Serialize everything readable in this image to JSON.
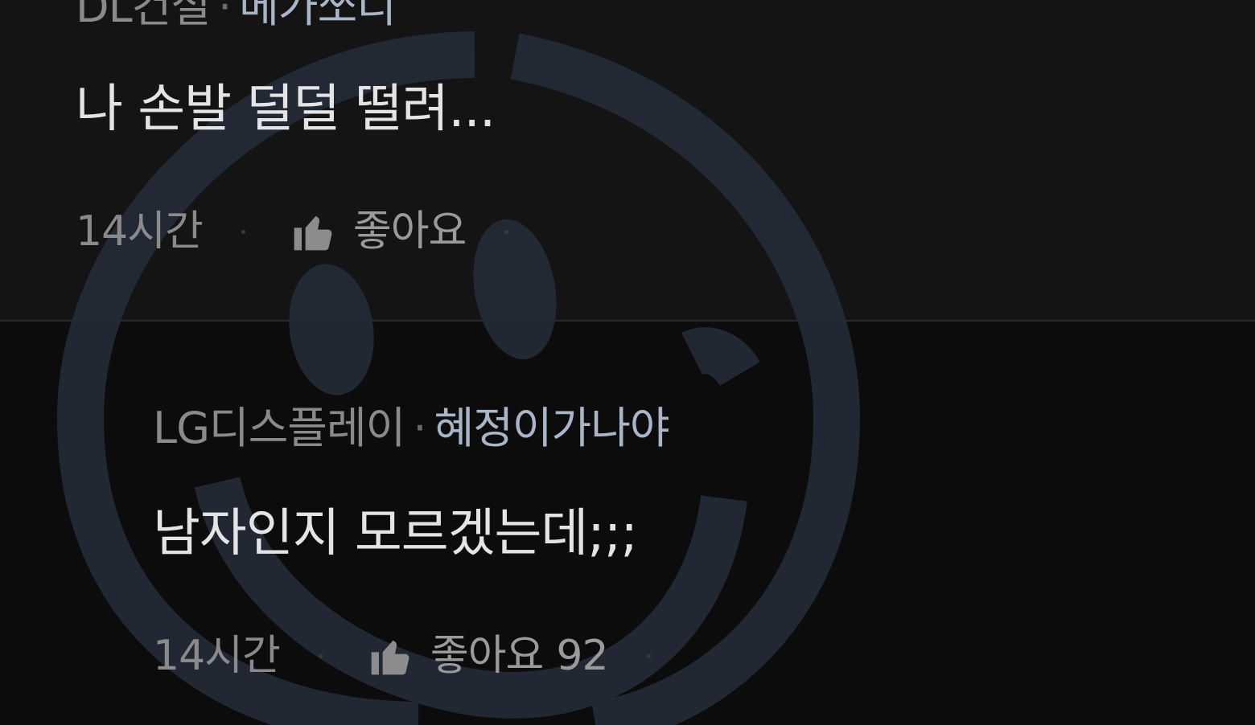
{
  "comments": [
    {
      "company": "DL건설",
      "separator": "·",
      "nickname": "메가쏘디",
      "text": "나 손발 덜덜 떨려...",
      "time": "14시간",
      "like_label": "좋아요",
      "like_count": ""
    },
    {
      "company": "LG디스플레이",
      "separator": "·",
      "nickname": "혜정이가나야",
      "text": "남자인지 모르겠는데;;;",
      "time": "14시간",
      "like_label": "좋아요",
      "like_count": "92"
    }
  ],
  "icons": {
    "like": "thumbs-up-icon",
    "watermark": "smiley-face-watermark"
  },
  "colors": {
    "background_top": "#141415",
    "background_bottom": "#0c0c0d",
    "nickname": "#a9b6c8",
    "company": "#8a8a8c",
    "body_text": "#e4e4e6",
    "watermark": "#232a36",
    "badge": "#b3261e"
  }
}
